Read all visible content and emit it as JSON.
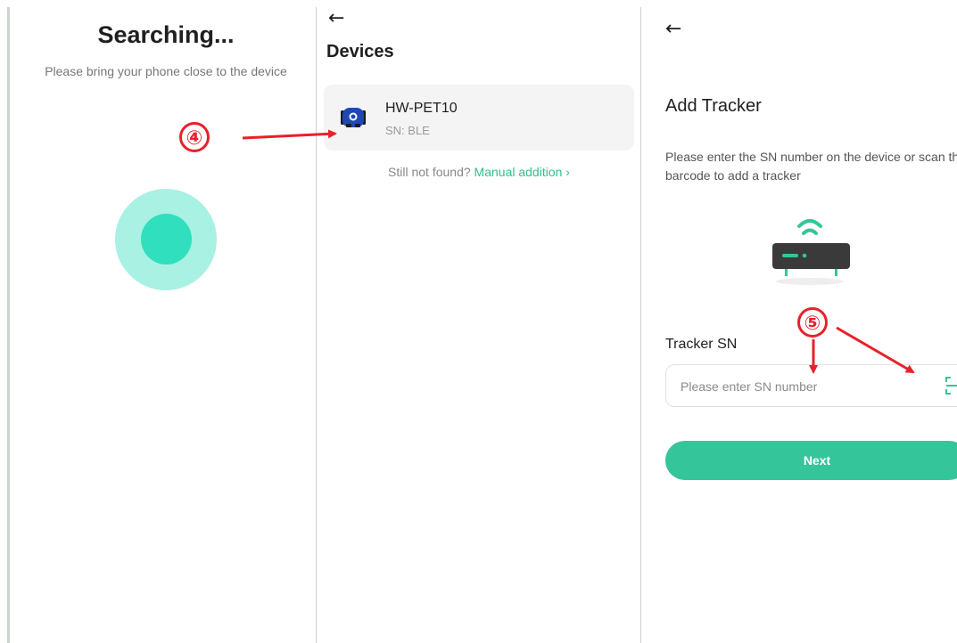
{
  "screen1": {
    "title": "Searching...",
    "subtitle": "Please bring your phone close to the device"
  },
  "screen2": {
    "title": "Devices",
    "back_icon": "arrow-left-icon",
    "device": {
      "name": "HW-PET10",
      "sn": "SN: BLE",
      "icon": "pet-tracker-icon"
    },
    "not_found_text": "Still not found?",
    "manual_link": "Manual addition",
    "manual_chevron": "›"
  },
  "screen3": {
    "back_icon": "arrow-left-icon",
    "title": "Add Tracker",
    "description": "Please enter the SN number on the device or scan the barcode to add a tracker",
    "sn_label": "Tracker SN",
    "sn_placeholder": "Please enter SN number",
    "sn_value": "",
    "scan_icon": "barcode-scan-icon",
    "next_label": "Next"
  },
  "annotations": {
    "step4": "④",
    "step5": "⑤"
  },
  "colors": {
    "accent": "#35c59a",
    "link": "#2fbf90",
    "pulse_outer": "#a9f1e3",
    "pulse_inner": "#2fdfbd",
    "annotation": "#e8212b",
    "device_blue": "#1f47b8",
    "router_body": "#3a3a3a"
  }
}
